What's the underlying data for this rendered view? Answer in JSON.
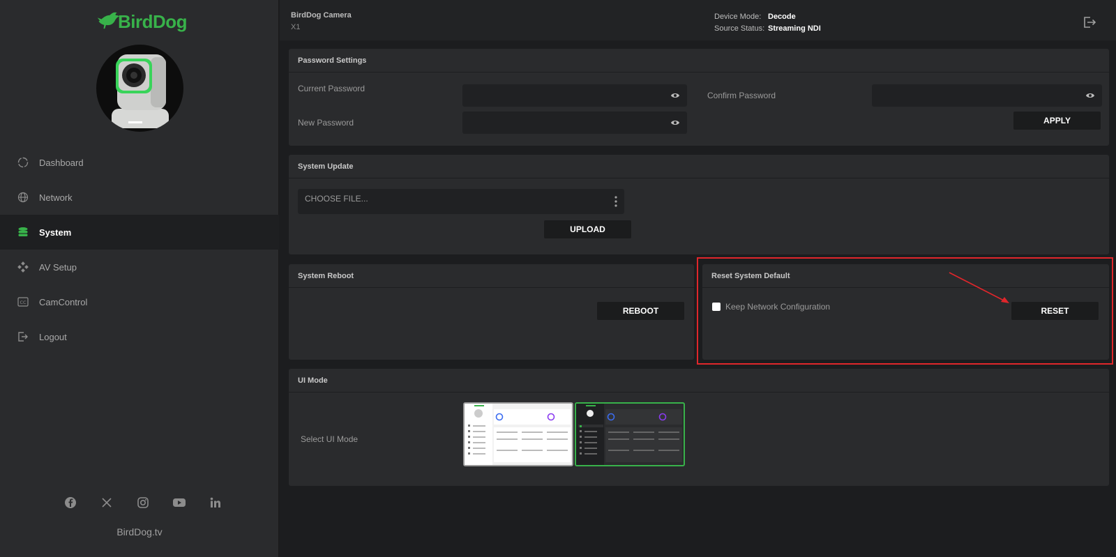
{
  "brand": {
    "name": "BirdDog",
    "color": "#38b24a",
    "site": "BirdDog.tv"
  },
  "sidebar": {
    "items": [
      {
        "label": "Dashboard",
        "icon": "dashboard-icon",
        "active": false
      },
      {
        "label": "Network",
        "icon": "globe-icon",
        "active": false
      },
      {
        "label": "System",
        "icon": "database-icon",
        "active": true
      },
      {
        "label": "AV Setup",
        "icon": "av-setup-icon",
        "active": false
      },
      {
        "label": "CamControl",
        "icon": "cc-icon",
        "active": false
      },
      {
        "label": "Logout",
        "icon": "logout-icon",
        "active": false
      }
    ],
    "social": [
      "facebook-icon",
      "x-icon",
      "instagram-icon",
      "youtube-icon",
      "linkedin-icon"
    ]
  },
  "header": {
    "camera_name": "BirdDog Camera",
    "camera_model": "X1",
    "device_mode_label": "Device Mode:",
    "device_mode_value": "Decode",
    "source_status_label": "Source Status:",
    "source_status_value": "Streaming NDI"
  },
  "password": {
    "title": "Password Settings",
    "current_label": "Current Password",
    "new_label": "New Password",
    "confirm_label": "Confirm Password",
    "apply_label": "APPLY"
  },
  "update": {
    "title": "System Update",
    "choose_label": "CHOOSE FILE...",
    "upload_label": "UPLOAD"
  },
  "reboot": {
    "title": "System Reboot",
    "reboot_label": "REBOOT"
  },
  "reset": {
    "title": "Reset System Default",
    "keep_network_label": "Keep Network Configuration",
    "keep_network_checked": false,
    "reset_label": "RESET"
  },
  "ui_mode": {
    "title": "UI Mode",
    "select_label": "Select UI Mode",
    "options": [
      "light",
      "dark"
    ],
    "selected": "dark"
  },
  "colors": {
    "accent": "#38b24a",
    "highlight": "#e0262b"
  }
}
